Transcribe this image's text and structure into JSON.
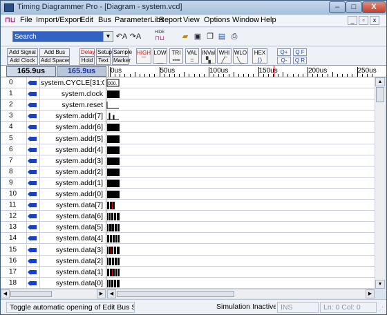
{
  "window": {
    "title": "Timing Diagrammer Pro - [Diagram - system.vcd]",
    "min_label": "–",
    "max_label": "□",
    "close_label": "X"
  },
  "menu": {
    "items": [
      "File",
      "Import/Export",
      "Edit",
      "Bus",
      "ParameterLibs",
      "Report",
      "View",
      "Options",
      "Window",
      "Help"
    ],
    "mdi_buttons": [
      "_",
      "▫",
      "x"
    ]
  },
  "toolbar": {
    "search_value": "Search",
    "hide_label": "HIDE",
    "icons": [
      "find-back-icon",
      "find-forward-icon",
      "open-folder-icon",
      "save-icon",
      "copy-icon",
      "export-icon",
      "print-icon"
    ]
  },
  "toolbar2": {
    "add_signal": "Add Signal",
    "add_bus": "Add Bus",
    "add_clock": "Add Clock",
    "add_spacer": "Add Spacer",
    "delay": "Delay",
    "setup": "Setup",
    "sample": "Sample",
    "hold": "Hold",
    "text": "Text",
    "marker": "Marker",
    "wave_buttons": [
      "HIGH",
      "LOW",
      "TRI",
      "VAL",
      "INVal",
      "WHI",
      "WLO",
      "HEX"
    ],
    "zoom_buttons": [
      "Q+",
      "Q F",
      "Q-",
      "Q R"
    ]
  },
  "timebar": {
    "time_a": "165.9us",
    "time_b": "165.9us",
    "ticks": [
      "0us",
      "50us",
      "100us",
      "150us",
      "200us",
      "250us"
    ]
  },
  "signals": [
    {
      "index": "0",
      "name": "system.CYCLE[31:0]",
      "value_text": "000."
    },
    {
      "index": "1",
      "name": "system.clock"
    },
    {
      "index": "2",
      "name": "system.reset"
    },
    {
      "index": "3",
      "name": "system.addr[7]"
    },
    {
      "index": "4",
      "name": "system.addr[6]"
    },
    {
      "index": "5",
      "name": "system.addr[5]"
    },
    {
      "index": "6",
      "name": "system.addr[4]"
    },
    {
      "index": "7",
      "name": "system.addr[3]"
    },
    {
      "index": "8",
      "name": "system.addr[2]"
    },
    {
      "index": "9",
      "name": "system.addr[1]"
    },
    {
      "index": "10",
      "name": "system.addr[0]"
    },
    {
      "index": "11",
      "name": "system.data[7]"
    },
    {
      "index": "12",
      "name": "system.data[6]"
    },
    {
      "index": "13",
      "name": "system.data[5]"
    },
    {
      "index": "14",
      "name": "system.data[4]"
    },
    {
      "index": "15",
      "name": "system.data[3]"
    },
    {
      "index": "16",
      "name": "system.data[2]"
    },
    {
      "index": "17",
      "name": "system.data[1]"
    },
    {
      "index": "18",
      "name": "system.data[0]"
    }
  ],
  "statusbar": {
    "message": "Toggle automatic opening of Edit Bus S",
    "sim_state": "Simulation Inactive",
    "ins": "INS",
    "position": "Ln: 0  Col: 0"
  },
  "colors": {
    "accent": "#1a3fd0",
    "marker": "#d01010",
    "waveform": "#000000"
  }
}
